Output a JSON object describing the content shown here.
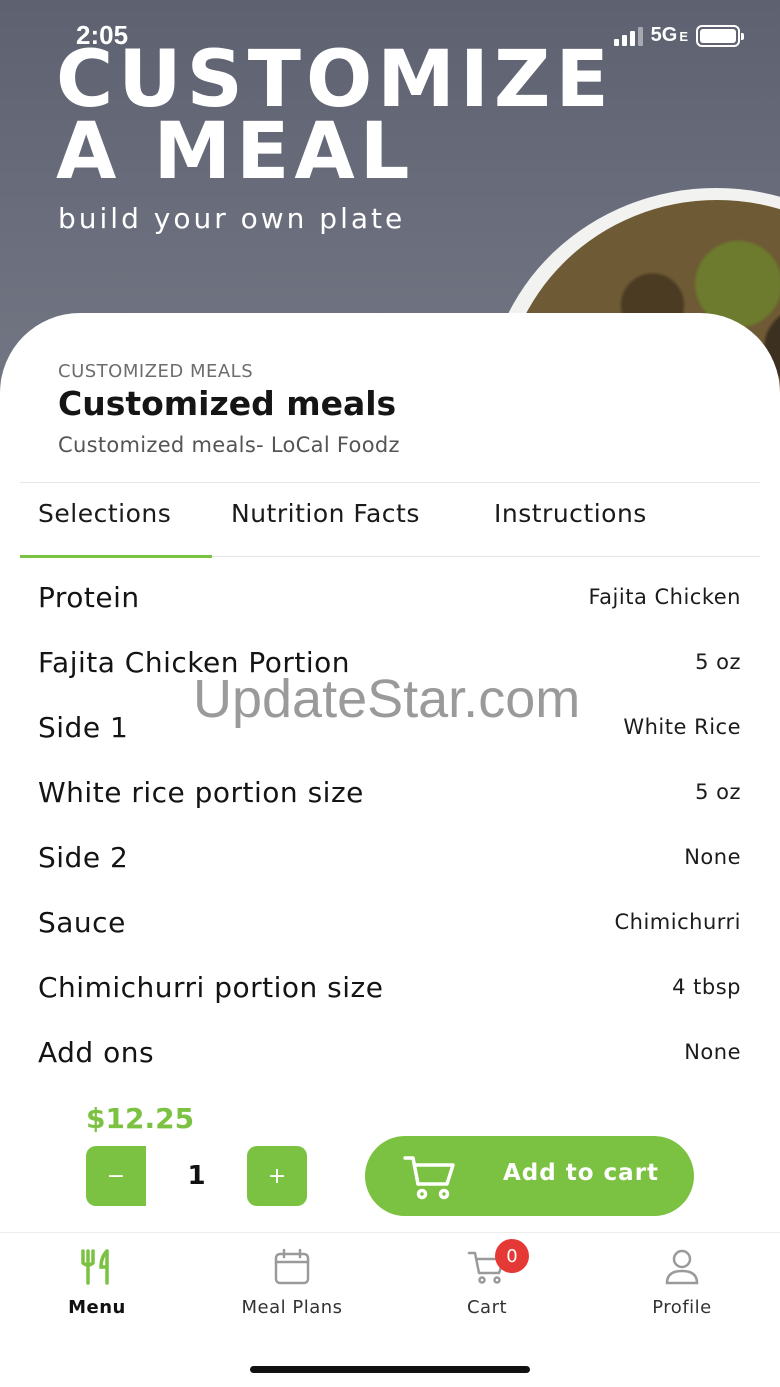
{
  "status_bar": {
    "time": "2:05",
    "network": "5G",
    "network_suffix": "E"
  },
  "hero": {
    "title_line1": "CUSTOMIZE",
    "title_line2": "A MEAL",
    "subtitle": "build your own plate"
  },
  "meal": {
    "category": "CUSTOMIZED MEALS",
    "title": "Customized meals",
    "description": "Customized meals- LoCal Foodz"
  },
  "tabs": [
    {
      "label": "Selections",
      "active": true
    },
    {
      "label": "Nutrition Facts",
      "active": false
    },
    {
      "label": "Instructions",
      "active": false
    }
  ],
  "selections": [
    {
      "label": "Protein",
      "value": "Fajita Chicken"
    },
    {
      "label": "Fajita Chicken Portion",
      "value": "5 oz"
    },
    {
      "label": "Side 1",
      "value": "White Rice"
    },
    {
      "label": "White rice portion size",
      "value": "5 oz"
    },
    {
      "label": "Side 2",
      "value": "None"
    },
    {
      "label": "Sauce",
      "value": "Chimichurri"
    },
    {
      "label": "Chimichurri portion size",
      "value": "4 tbsp"
    },
    {
      "label": "Add ons",
      "value": "None"
    }
  ],
  "watermark": "UpdateStar.com",
  "order": {
    "price": "$12.25",
    "minus_label": "−",
    "quantity": "1",
    "plus_label": "+",
    "add_to_cart_label": "Add to cart"
  },
  "bottom_nav": [
    {
      "label": "Menu",
      "icon": "fork-knife-icon",
      "active": true
    },
    {
      "label": "Meal Plans",
      "icon": "calendar-icon",
      "active": false
    },
    {
      "label": "Cart",
      "icon": "cart-icon",
      "active": false,
      "badge": "0"
    },
    {
      "label": "Profile",
      "icon": "person-icon",
      "active": false
    }
  ],
  "colors": {
    "accent": "#7cc242",
    "badge": "#e53935",
    "hero_bg": "#6b6f7d"
  }
}
